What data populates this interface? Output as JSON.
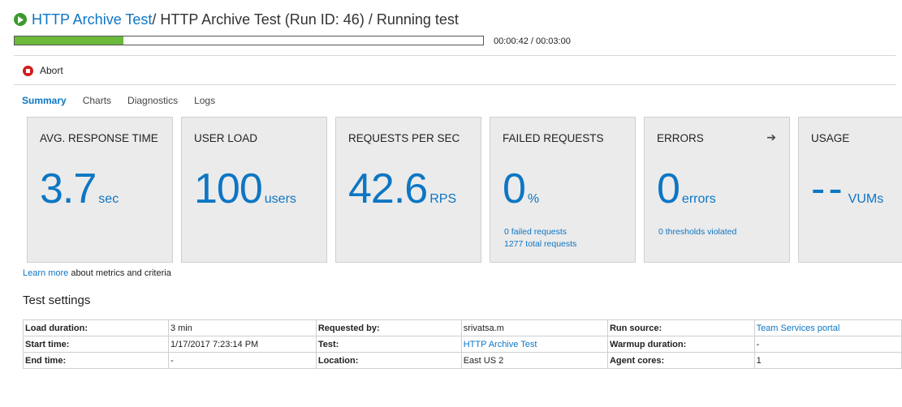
{
  "header": {
    "title_link": "HTTP Archive Test",
    "title_rest": " / HTTP Archive Test (Run ID: 46) / Running test",
    "run_icon": "play-circle-icon"
  },
  "progress": {
    "elapsed": "00:00:42 / 00:03:00",
    "fraction": 0.233,
    "fill_color": "#6ab93b"
  },
  "toolbar": {
    "abort_label": "Abort",
    "abort_icon": "stop-circle-icon"
  },
  "tabs": [
    {
      "label": "Summary",
      "active": true
    },
    {
      "label": "Charts",
      "active": false
    },
    {
      "label": "Diagnostics",
      "active": false
    },
    {
      "label": "Logs",
      "active": false
    }
  ],
  "cards": {
    "response": {
      "title": "AVG. RESPONSE TIME",
      "value": "3.7",
      "unit": "sec"
    },
    "load": {
      "title": "USER LOAD",
      "value": "100",
      "unit": "users"
    },
    "rps": {
      "title": "REQUESTS PER SEC",
      "value": "42.6",
      "unit": "RPS"
    },
    "failed": {
      "title": "FAILED REQUESTS",
      "value": "0",
      "unit": "%",
      "line1": "0 failed requests",
      "line2": "1277 total requests"
    },
    "errors": {
      "title": "ERRORS",
      "value": "0",
      "unit": "errors",
      "line1": "0 thresholds violated",
      "arrow": "➔"
    },
    "usage": {
      "title": "USAGE",
      "value": "--",
      "unit": "VUMs"
    }
  },
  "learn": {
    "link": "Learn more",
    "rest": " about metrics and criteria"
  },
  "settings": {
    "title": "Test settings",
    "rows": [
      [
        {
          "text": "Load duration:"
        },
        {
          "text": "3 min"
        },
        {
          "text": "Requested by:"
        },
        {
          "text": "srivatsa.m"
        },
        {
          "text": "Run source:"
        },
        {
          "text": "Team Services portal",
          "link": true
        }
      ],
      [
        {
          "text": "Start time:"
        },
        {
          "text": "1/17/2017 7:23:14 PM"
        },
        {
          "text": "Test:"
        },
        {
          "text": "HTTP Archive Test",
          "link": true
        },
        {
          "text": "Warmup duration:"
        },
        {
          "text": "-"
        }
      ],
      [
        {
          "text": "End time:"
        },
        {
          "text": "-"
        },
        {
          "text": "Location:"
        },
        {
          "text": "East US 2"
        },
        {
          "text": "Agent cores:"
        },
        {
          "text": "1"
        }
      ]
    ]
  },
  "colors": {
    "accent": "#0d76c4",
    "success": "#3c9a2e",
    "danger": "#d21c1c",
    "card_bg": "#ebebeb"
  }
}
